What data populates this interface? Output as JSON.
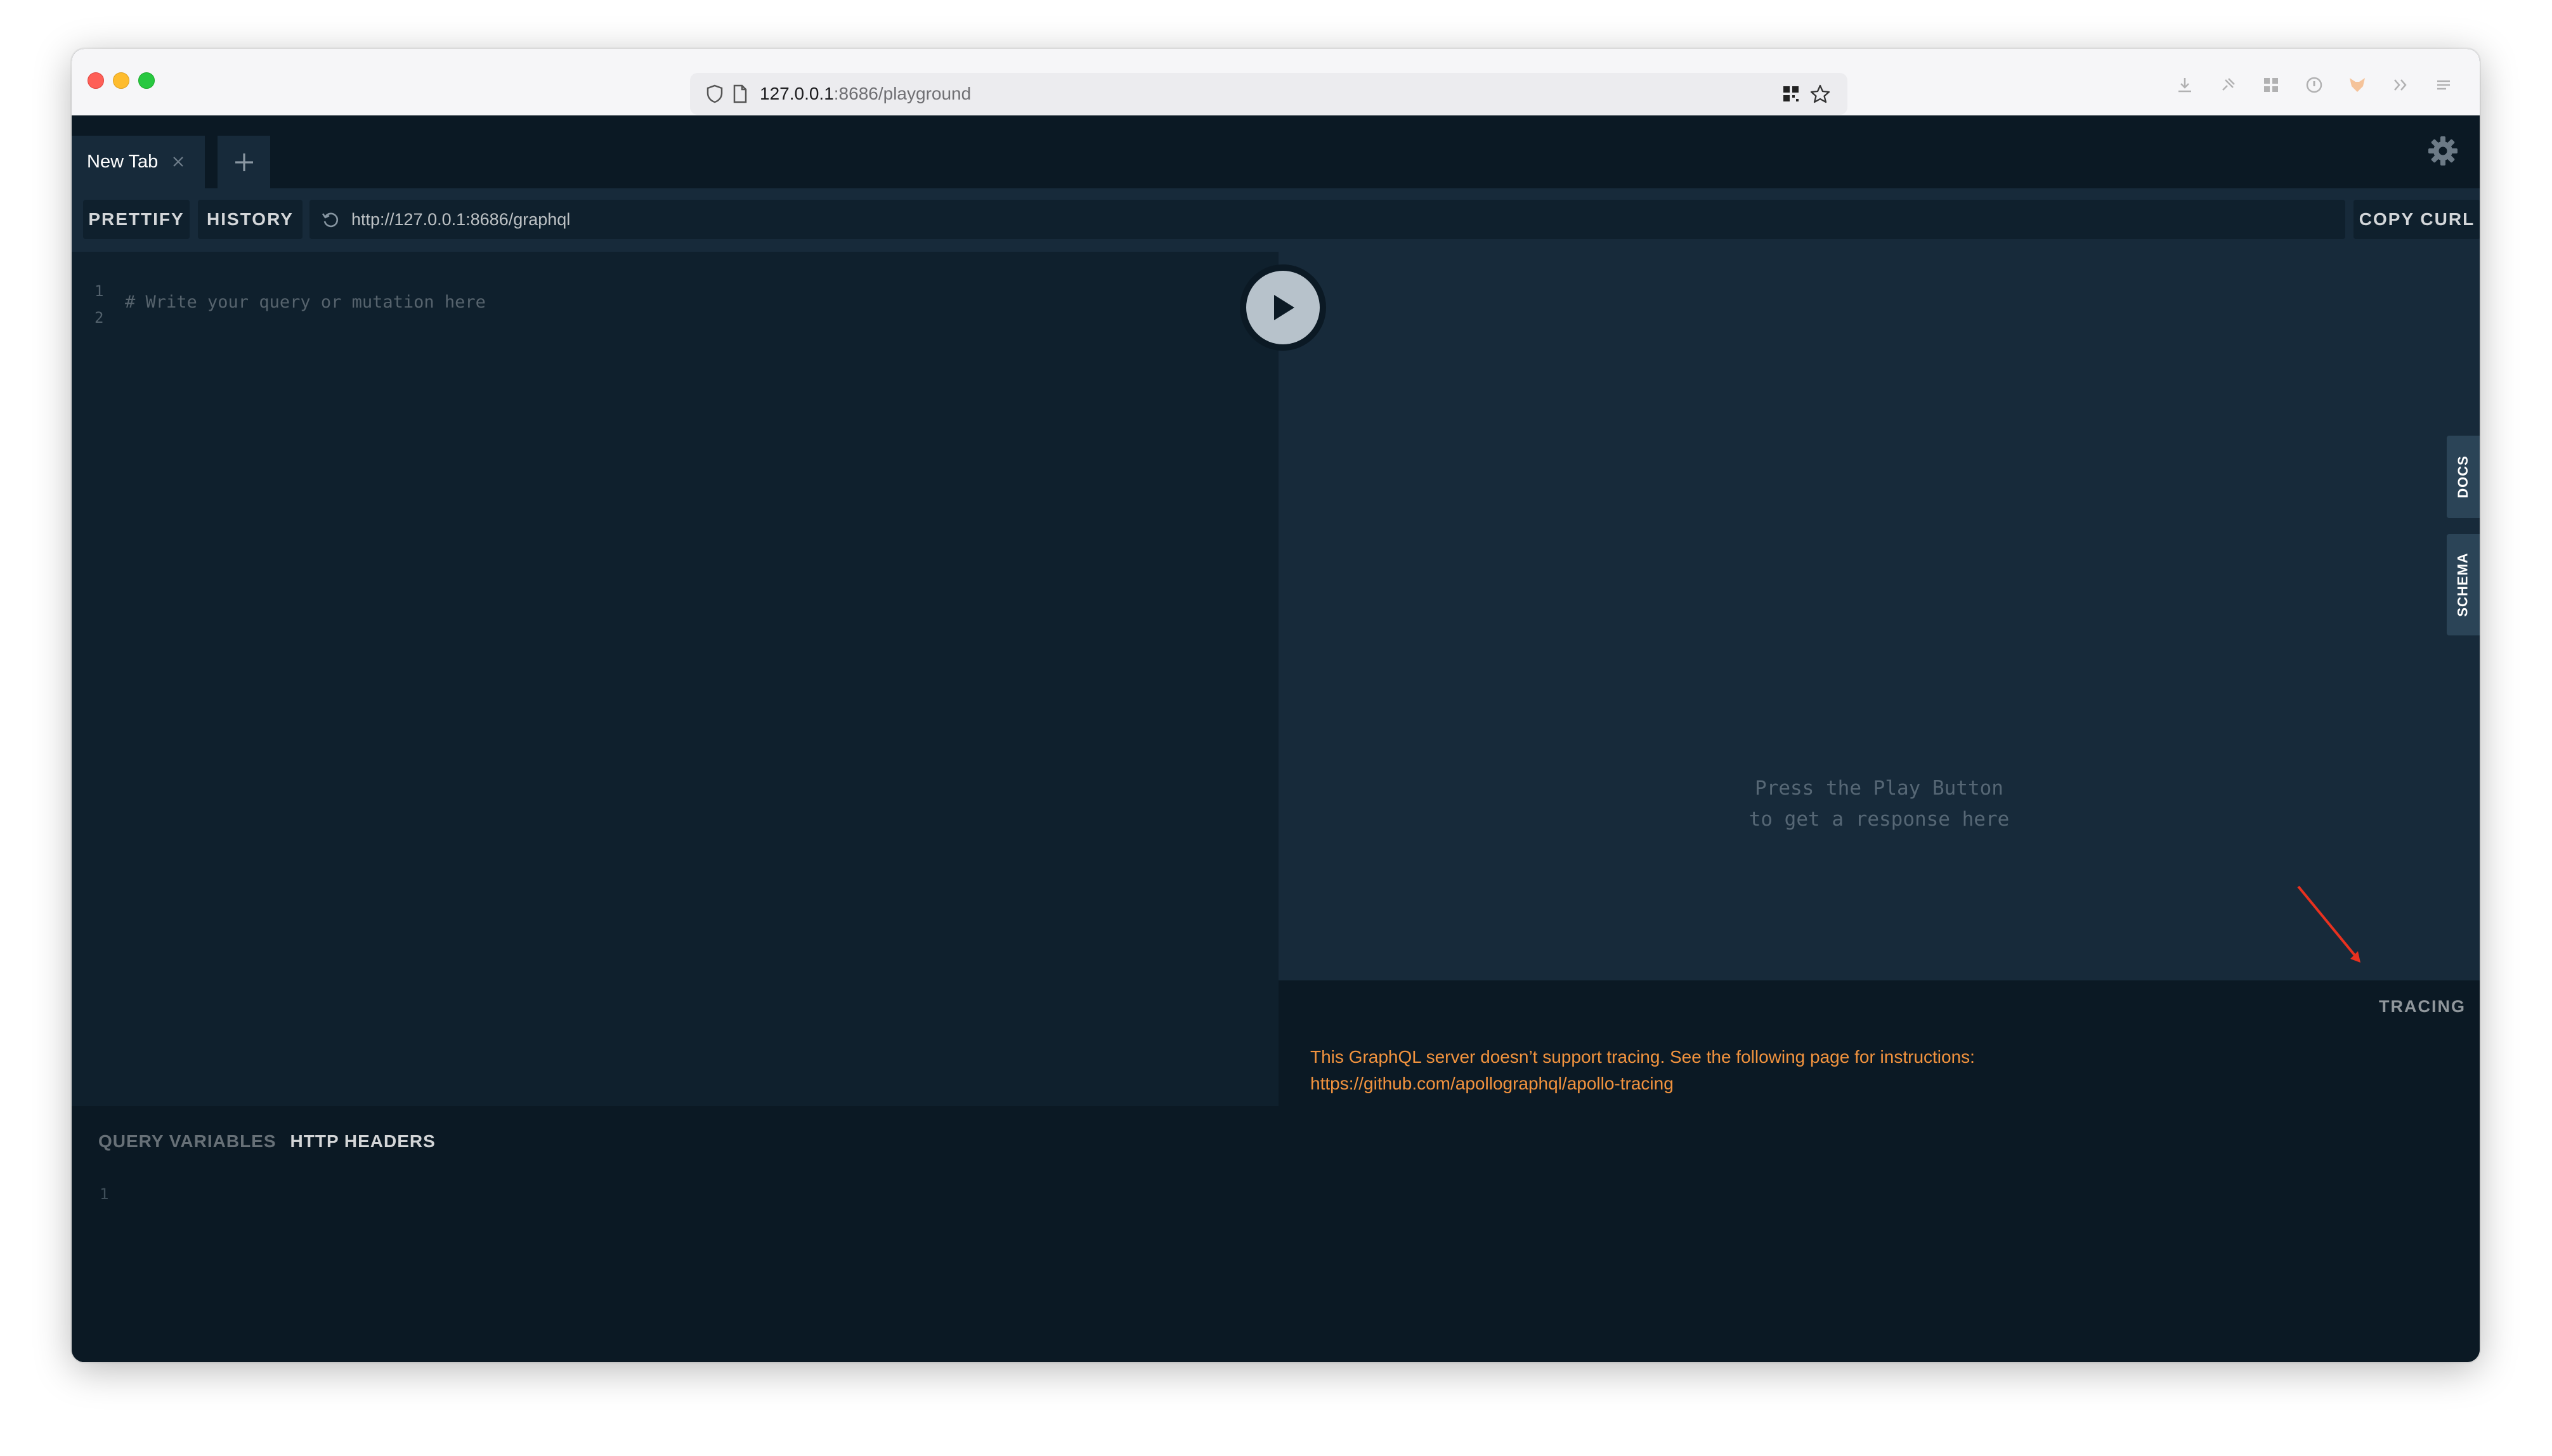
{
  "browser": {
    "url_host": "127.0.0.1",
    "url_rest": ":8686/playground"
  },
  "tabs": [
    {
      "label": "New Tab"
    }
  ],
  "toolbar": {
    "prettify_label": "PRETTIFY",
    "history_label": "HISTORY",
    "endpoint_url": "http://127.0.0.1:8686/graphql",
    "copy_curl_label": "COPY CURL"
  },
  "editor": {
    "line_numbers": [
      "1",
      "2"
    ],
    "placeholder": "# Write your query or mutation here"
  },
  "result": {
    "placeholder_line1": "Press the Play Button",
    "placeholder_line2": "to get a response here"
  },
  "side_tabs": {
    "docs": "DOCS",
    "schema": "SCHEMA"
  },
  "tracing": {
    "title": "TRACING",
    "message_line1": "This GraphQL server doesn’t support tracing. See the following page for instructions:",
    "message_line2": "https://github.com/apollographql/apollo-tracing"
  },
  "variables": {
    "query_variables_label": "QUERY VARIABLES",
    "http_headers_label": "HTTP HEADERS",
    "line_number": "1"
  },
  "colors": {
    "annotation_arrow": "#e8311f",
    "tracing_text": "#f2933e"
  }
}
